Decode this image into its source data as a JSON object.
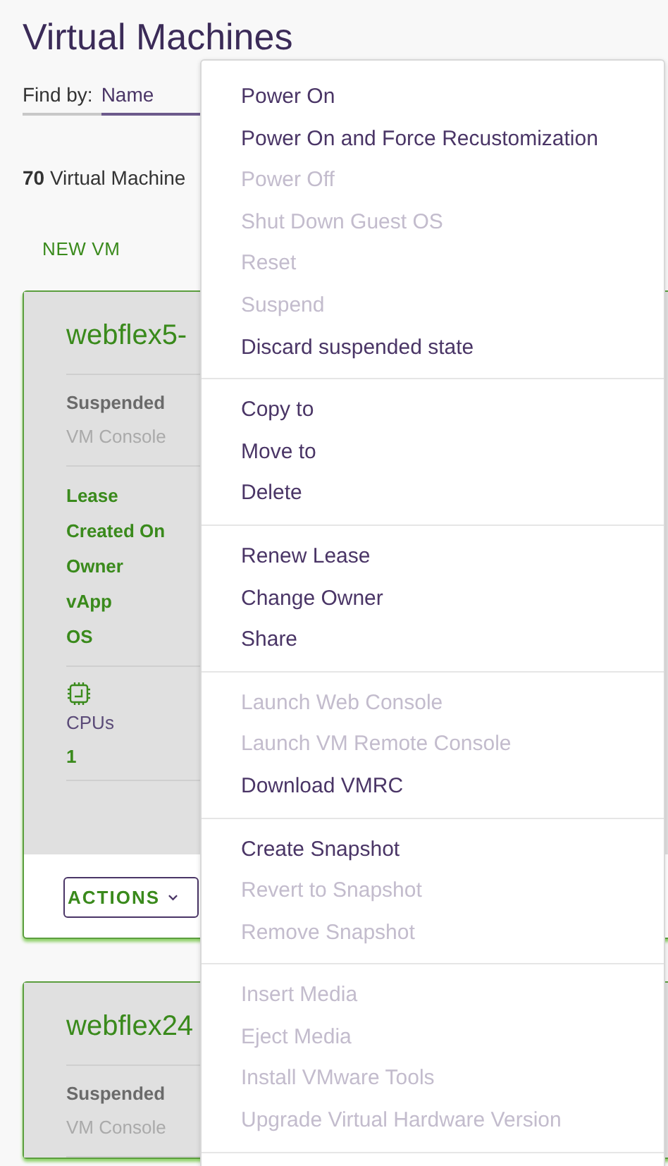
{
  "page_title": "Virtual Machines",
  "find_by": {
    "label": "Find by:",
    "value": "Name"
  },
  "count": {
    "number": "70",
    "label": "Virtual Machine"
  },
  "new_vm_button": "NEW VM",
  "vms": [
    {
      "name": "webflex5-",
      "status": "Suspended",
      "console": "VM Console",
      "fields": [
        "Lease",
        "Created On",
        "Owner",
        "vApp",
        "OS"
      ],
      "stats": [
        {
          "label": "CPUs",
          "value": "1"
        }
      ],
      "actions_button": "ACTIONS"
    },
    {
      "name": "webflex24",
      "status": "Suspended",
      "console": "VM Console"
    }
  ],
  "context_menu": {
    "groups": [
      [
        {
          "label": "Power On",
          "disabled": false
        },
        {
          "label": "Power On and Force Recustomization",
          "disabled": false
        },
        {
          "label": "Power Off",
          "disabled": true
        },
        {
          "label": "Shut Down Guest OS",
          "disabled": true
        },
        {
          "label": "Reset",
          "disabled": true
        },
        {
          "label": "Suspend",
          "disabled": true
        },
        {
          "label": "Discard suspended state",
          "disabled": false
        }
      ],
      [
        {
          "label": "Copy to",
          "disabled": false
        },
        {
          "label": "Move to",
          "disabled": false
        },
        {
          "label": "Delete",
          "disabled": false
        }
      ],
      [
        {
          "label": "Renew Lease",
          "disabled": false
        },
        {
          "label": "Change Owner",
          "disabled": false
        },
        {
          "label": "Share",
          "disabled": false
        }
      ],
      [
        {
          "label": "Launch Web Console",
          "disabled": true
        },
        {
          "label": "Launch VM Remote Console",
          "disabled": true
        },
        {
          "label": "Download VMRC",
          "disabled": false
        }
      ],
      [
        {
          "label": "Create Snapshot",
          "disabled": false
        },
        {
          "label": "Revert to Snapshot",
          "disabled": true
        },
        {
          "label": "Remove Snapshot",
          "disabled": true
        }
      ],
      [
        {
          "label": "Insert Media",
          "disabled": true
        },
        {
          "label": "Eject Media",
          "disabled": true
        },
        {
          "label": "Install VMware Tools",
          "disabled": true
        },
        {
          "label": "Upgrade Virtual Hardware Version",
          "disabled": true
        }
      ]
    ]
  }
}
